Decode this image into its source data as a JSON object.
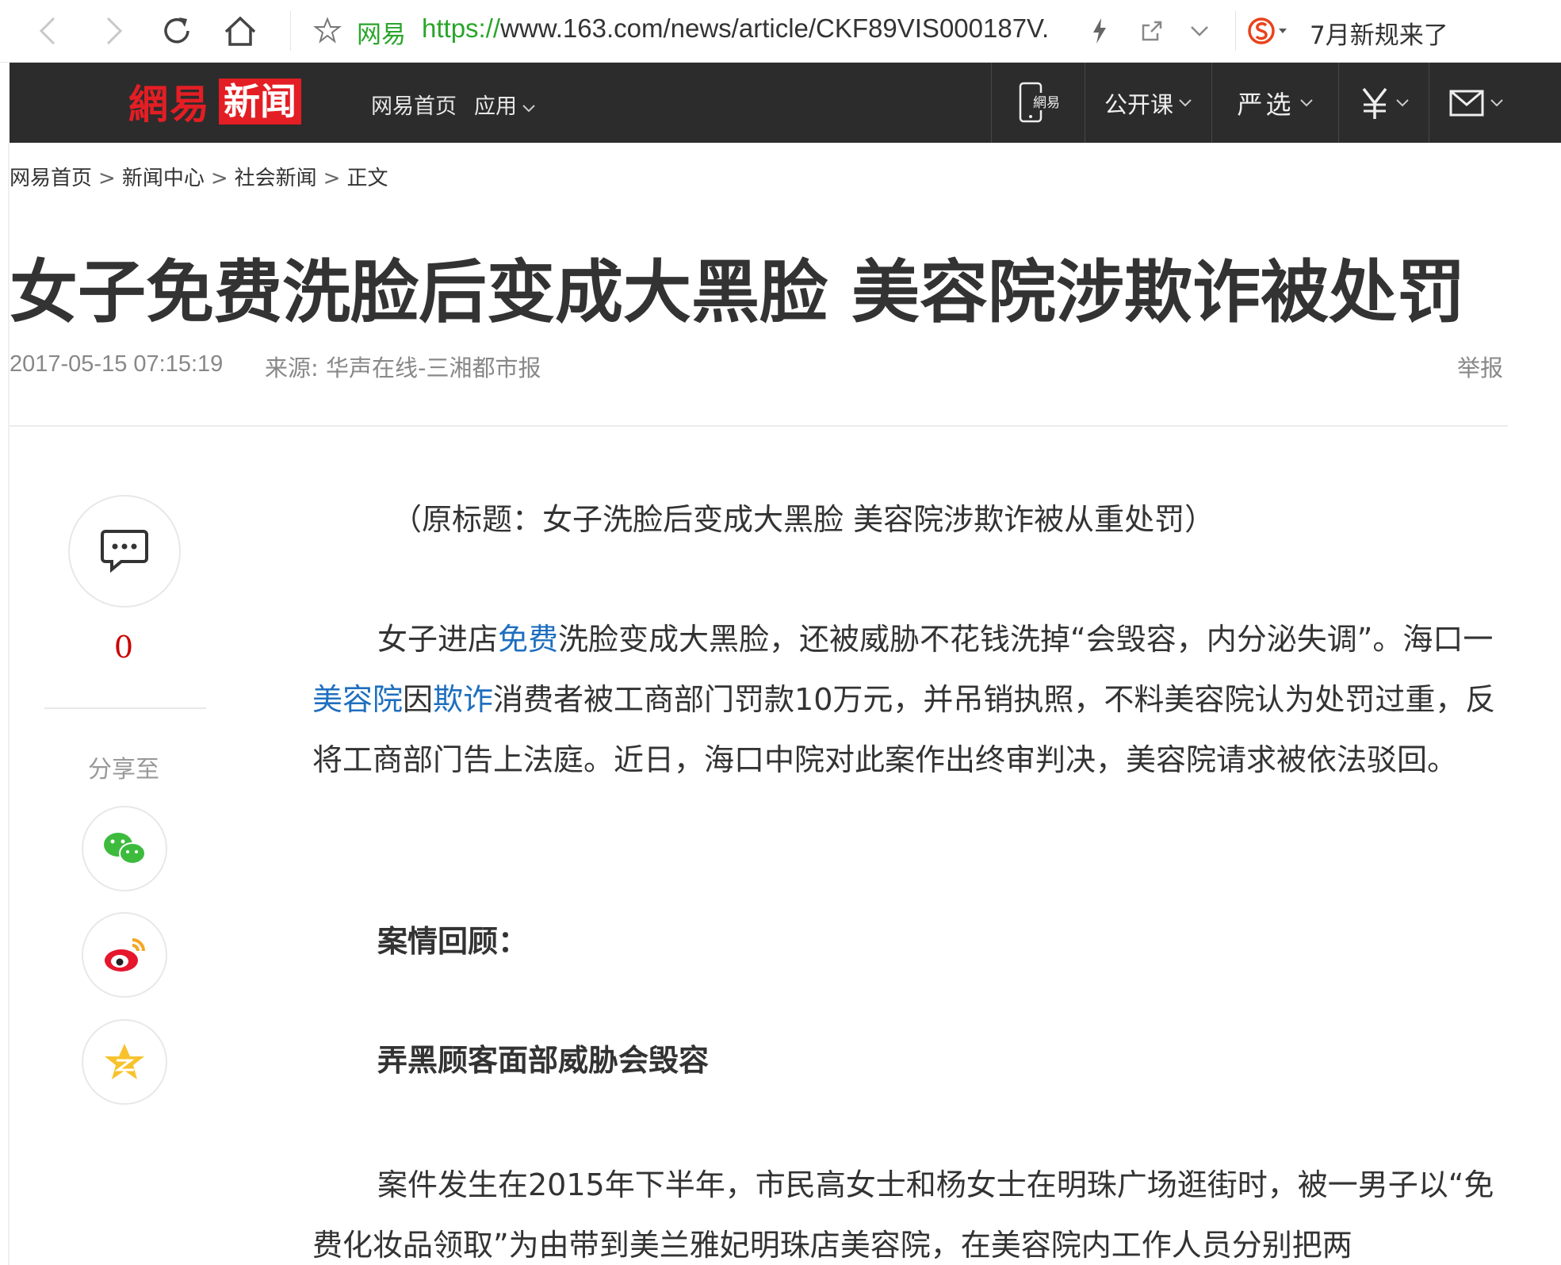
{
  "browser": {
    "site_name": "网易",
    "url_protocol": "https://",
    "url_rest": "www.163.com/news/article/CKF89VIS000187V.",
    "notice": "7月新规来了"
  },
  "nav": {
    "logo_netease": "網易",
    "logo_news": "新闻",
    "home": "网易首页",
    "app": "应用",
    "course": "公开课",
    "yanxuan": "严选",
    "mobile_label": "網易"
  },
  "breadcrumb": {
    "items": [
      "网易首页",
      "新闻中心",
      "社会新闻",
      "正文"
    ],
    "separator": ">"
  },
  "article": {
    "title": "女子免费洗脸后变成大黑脸 美容院涉欺诈被处罚",
    "date": "2017-05-15 07:15:19",
    "source": "来源: 华声在线-三湘都市报",
    "report": "举报",
    "original_title": "（原标题：女子洗脸后变成大黑脸 美容院涉欺诈被从重处罚）",
    "p1": {
      "t1": "女子进店",
      "link1": "免费",
      "t2": "洗脸变成大黑脸，还被威胁不花钱洗掉“会毁容，内分泌失调”。海口一",
      "link2": "美容院",
      "t3": "因",
      "link3": "欺诈",
      "t4": "消费者被工商部门罚款10万元，并吊销执照，不料美容院认为处罚过重，反将工商部门告上法庭。近日，海口中院对此案作出终审判决，美容院请求被依法驳回。"
    },
    "subheading1": "案情回顾：",
    "subheading2": "弄黑顾客面部威胁会毁容",
    "p2": "案件发生在2015年下半年，市民高女士和杨女士在明珠广场逛街时，被一男子以“免费化妆品领取”为由带到美兰雅妃明珠店美容院，在美容院内工作人员分别把两"
  },
  "sidebar": {
    "comment_count": "0",
    "share_label": "分享至"
  },
  "colors": {
    "nav_bg": "#2c2c2c",
    "brand_red": "#e31e24",
    "link_blue": "#1f6fbf",
    "url_green": "#2aa52a"
  }
}
